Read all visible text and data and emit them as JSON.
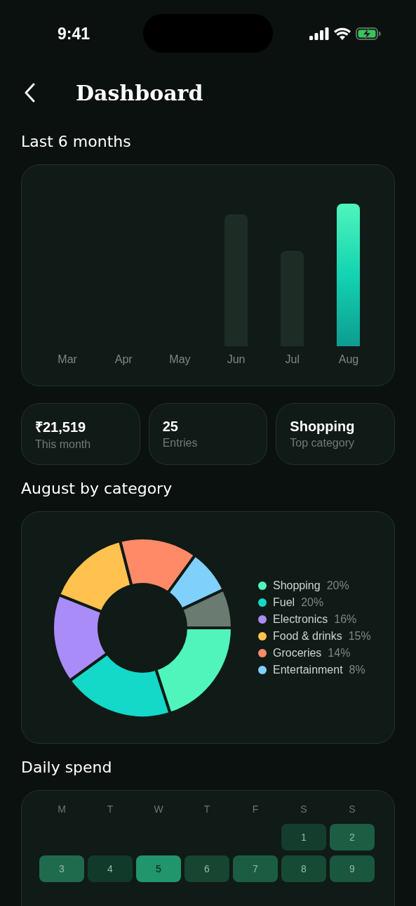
{
  "status_bar": {
    "time": "9:41"
  },
  "header": {
    "title": "Dashboard"
  },
  "trend": {
    "title": "Last 6 months",
    "months": [
      {
        "label": "Mar"
      },
      {
        "label": "Apr"
      },
      {
        "label": "May"
      },
      {
        "label": "Jun"
      },
      {
        "label": "Jul"
      },
      {
        "label": "Aug"
      }
    ]
  },
  "stats": [
    {
      "value": "₹21,519",
      "label": "This month"
    },
    {
      "value": "25",
      "label": "Entries"
    },
    {
      "value": "Shopping",
      "label": "Top category"
    }
  ],
  "category": {
    "title": "August by category",
    "chart_data": {
      "type": "donut",
      "categories": [
        "Shopping",
        "Fuel",
        "Electronics",
        "Food & drinks",
        "Groceries",
        "Entertainment",
        null
      ],
      "values": [
        20,
        20,
        16,
        15,
        14,
        8,
        7
      ]
    },
    "legend": [
      {
        "percent": "20%",
        "color": "#4ff5bb"
      },
      {
        "percent": "20%",
        "color": "#14d9c8"
      },
      {
        "percent": "16%",
        "color": "#a98cf8"
      },
      {
        "percent": "15%",
        "color": "#ffc24e"
      },
      {
        "percent": "14%",
        "color": "#ff8a68"
      },
      {
        "percent": "8%",
        "color": "#7fd1fc"
      }
    ]
  },
  "daily": {
    "title": "Daily spend",
    "weekdays": [
      "M",
      "T",
      "W",
      "T",
      "F",
      "S",
      "S"
    ],
    "weeks": [
      [
        {
          "kind": "empty"
        },
        {
          "kind": "empty"
        },
        {
          "kind": "empty"
        },
        {
          "kind": "empty"
        },
        {
          "kind": "empty"
        },
        {
          "kind": "day",
          "day": "1",
          "color": "#153d2d"
        },
        {
          "kind": "day",
          "day": "2",
          "color": "#1b5e44"
        }
      ],
      [
        {
          "kind": "day",
          "day": "3",
          "color": "#1e6b4e"
        },
        {
          "kind": "day",
          "day": "4",
          "color": "#123a2a"
        },
        {
          "kind": "day",
          "day": "5",
          "color": "#21956b"
        },
        {
          "kind": "day",
          "day": "6",
          "color": "#164532"
        },
        {
          "kind": "day",
          "day": "7",
          "color": "#1b5d43"
        },
        {
          "kind": "day",
          "day": "8",
          "color": "#174a35"
        },
        {
          "kind": "day",
          "day": "9",
          "color": "#1a573f"
        }
      ]
    ]
  }
}
